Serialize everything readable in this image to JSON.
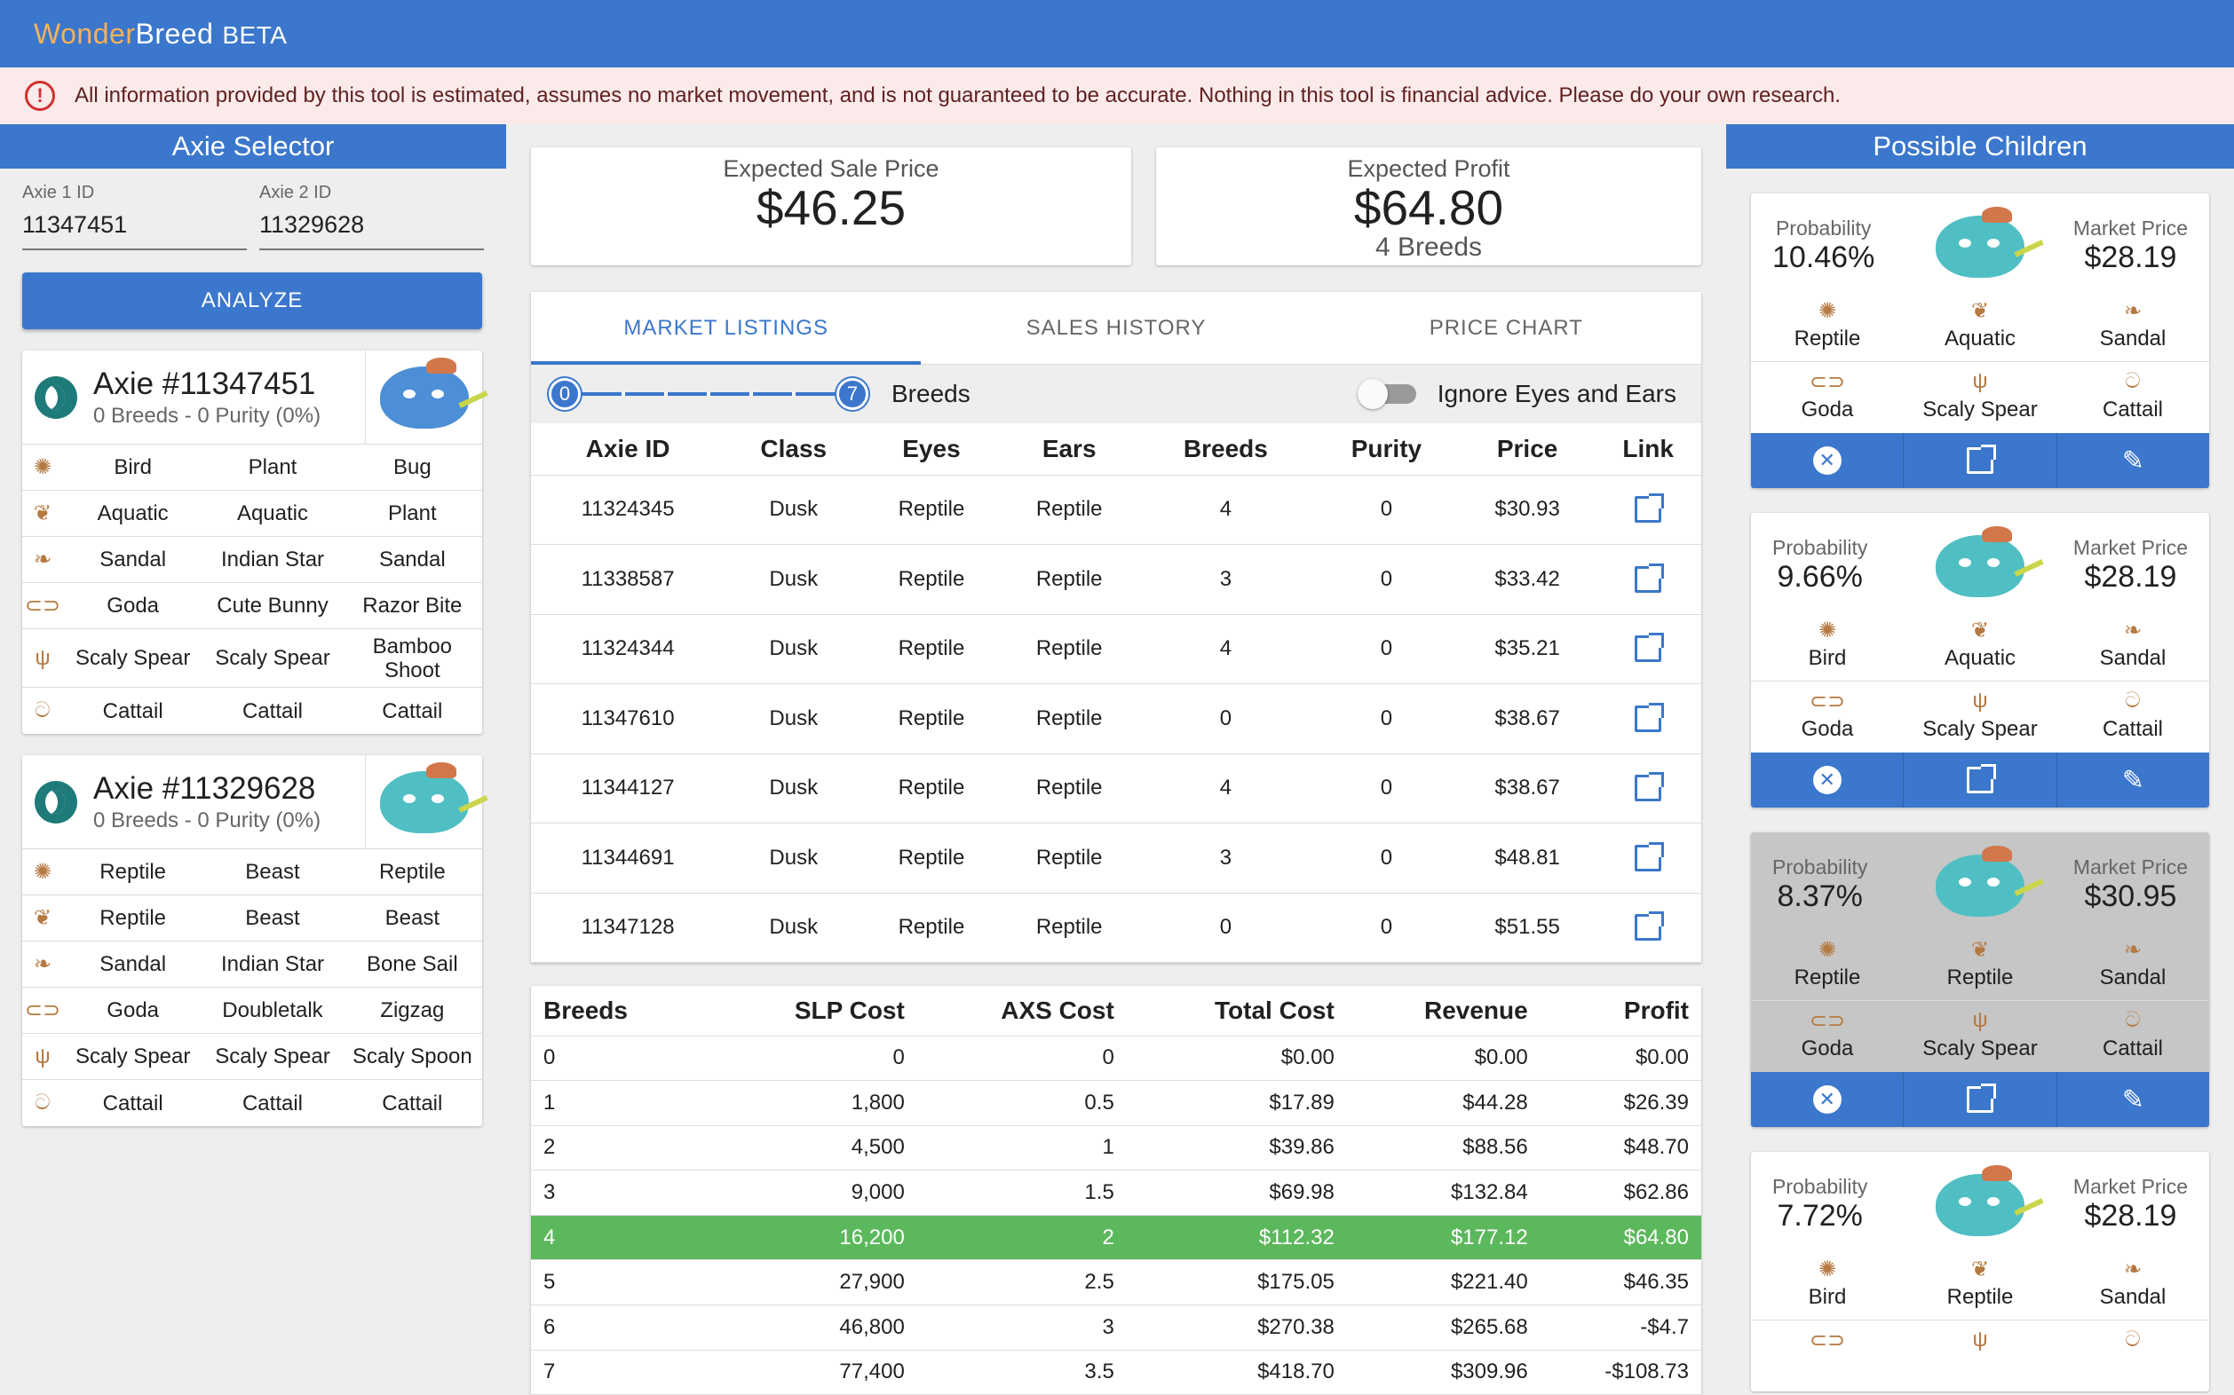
{
  "app": {
    "brand_wonder": "Wonder",
    "brand_breed": "Breed",
    "brand_beta": "BETA"
  },
  "alert": {
    "text": "All information provided by this tool is estimated, assumes no market movement, and is not guaranteed to be accurate. Nothing in this tool is financial advice. Please do your own research."
  },
  "selector": {
    "title": "Axie Selector",
    "axie1_label": "Axie 1 ID",
    "axie1_value": "11347451",
    "axie2_label": "Axie 2 ID",
    "axie2_value": "11329628",
    "analyze_label": "ANALYZE"
  },
  "axies": [
    {
      "title": "Axie #11347451",
      "sub": "0 Breeds - 0 Purity (0%)",
      "rows": [
        [
          "Bird",
          "Plant",
          "Bug"
        ],
        [
          "Aquatic",
          "Aquatic",
          "Plant"
        ],
        [
          "Sandal",
          "Indian Star",
          "Sandal"
        ],
        [
          "Goda",
          "Cute Bunny",
          "Razor Bite"
        ],
        [
          "Scaly Spear",
          "Scaly Spear",
          "Bamboo Shoot"
        ],
        [
          "Cattail",
          "Cattail",
          "Cattail"
        ]
      ]
    },
    {
      "title": "Axie #11329628",
      "sub": "0 Breeds - 0 Purity (0%)",
      "rows": [
        [
          "Reptile",
          "Beast",
          "Reptile"
        ],
        [
          "Reptile",
          "Beast",
          "Beast"
        ],
        [
          "Sandal",
          "Indian Star",
          "Bone Sail"
        ],
        [
          "Goda",
          "Doubletalk",
          "Zigzag"
        ],
        [
          "Scaly Spear",
          "Scaly Spear",
          "Scaly Spoon"
        ],
        [
          "Cattail",
          "Cattail",
          "Cattail"
        ]
      ]
    }
  ],
  "stats": {
    "sale_label": "Expected Sale Price",
    "sale_value": "$46.25",
    "profit_label": "Expected Profit",
    "profit_value": "$64.80",
    "profit_breeds": "4 Breeds"
  },
  "tabs": [
    "MARKET LISTINGS",
    "SALES HISTORY",
    "PRICE CHART"
  ],
  "filter": {
    "min": "0",
    "max": "7",
    "breeds_label": "Breeds",
    "toggle_label": "Ignore Eyes and Ears"
  },
  "listings": {
    "headers": [
      "Axie ID",
      "Class",
      "Eyes",
      "Ears",
      "Breeds",
      "Purity",
      "Price",
      "Link"
    ],
    "rows": [
      [
        "11324345",
        "Dusk",
        "Reptile",
        "Reptile",
        "4",
        "0",
        "$30.93"
      ],
      [
        "11338587",
        "Dusk",
        "Reptile",
        "Reptile",
        "3",
        "0",
        "$33.42"
      ],
      [
        "11324344",
        "Dusk",
        "Reptile",
        "Reptile",
        "4",
        "0",
        "$35.21"
      ],
      [
        "11347610",
        "Dusk",
        "Reptile",
        "Reptile",
        "0",
        "0",
        "$38.67"
      ],
      [
        "11344127",
        "Dusk",
        "Reptile",
        "Reptile",
        "4",
        "0",
        "$38.67"
      ],
      [
        "11344691",
        "Dusk",
        "Reptile",
        "Reptile",
        "3",
        "0",
        "$48.81"
      ],
      [
        "11347128",
        "Dusk",
        "Reptile",
        "Reptile",
        "0",
        "0",
        "$51.55"
      ]
    ]
  },
  "costs": {
    "headers": [
      "Breeds",
      "SLP Cost",
      "AXS Cost",
      "Total Cost",
      "Revenue",
      "Profit"
    ],
    "rows": [
      [
        "0",
        "0",
        "0",
        "$0.00",
        "$0.00",
        "$0.00"
      ],
      [
        "1",
        "1,800",
        "0.5",
        "$17.89",
        "$44.28",
        "$26.39"
      ],
      [
        "2",
        "4,500",
        "1",
        "$39.86",
        "$88.56",
        "$48.70"
      ],
      [
        "3",
        "9,000",
        "1.5",
        "$69.98",
        "$132.84",
        "$62.86"
      ],
      [
        "4",
        "16,200",
        "2",
        "$112.32",
        "$177.12",
        "$64.80"
      ],
      [
        "5",
        "27,900",
        "2.5",
        "$175.05",
        "$221.40",
        "$46.35"
      ],
      [
        "6",
        "46,800",
        "3",
        "$270.38",
        "$265.68",
        "-$4.7"
      ],
      [
        "7",
        "77,400",
        "3.5",
        "$418.70",
        "$309.96",
        "-$108.73"
      ]
    ],
    "highlight_index": 4
  },
  "children": {
    "title": "Possible Children",
    "prob_label": "Probability",
    "price_label": "Market Price",
    "items": [
      {
        "prob": "10.46%",
        "price": "$28.19",
        "row1": [
          "Reptile",
          "Aquatic",
          "Sandal"
        ],
        "row2": [
          "Goda",
          "Scaly Spear",
          "Cattail"
        ]
      },
      {
        "prob": "9.66%",
        "price": "$28.19",
        "row1": [
          "Bird",
          "Aquatic",
          "Sandal"
        ],
        "row2": [
          "Goda",
          "Scaly Spear",
          "Cattail"
        ]
      },
      {
        "prob": "8.37%",
        "price": "$30.95",
        "row1": [
          "Reptile",
          "Reptile",
          "Sandal"
        ],
        "row2": [
          "Goda",
          "Scaly Spear",
          "Cattail"
        ]
      },
      {
        "prob": "7.72%",
        "price": "$28.19",
        "row1": [
          "Bird",
          "Reptile",
          "Sandal"
        ],
        "row2": [
          "",
          "",
          ""
        ]
      }
    ]
  },
  "icons": [
    "eyes-icon",
    "ears-icon",
    "back-icon",
    "mouth-icon",
    "horn-icon",
    "tail-icon",
    "external-link-icon",
    "close-circle-icon",
    "edit-icon",
    "error-icon"
  ],
  "colors": {
    "primary": "#3b77cc",
    "highlight": "#5cb85c",
    "alert_bg": "#fbeaea"
  }
}
